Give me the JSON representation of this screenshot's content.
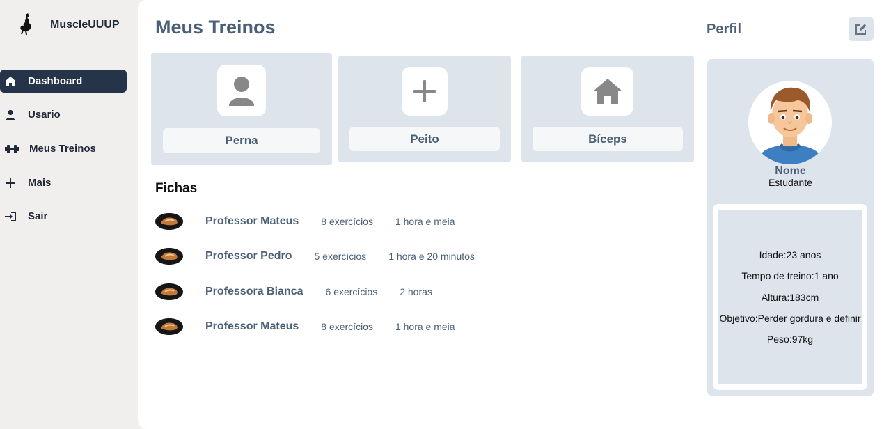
{
  "brand": {
    "name": "MuscleUUUP",
    "logo_icon": "muscle-logo-icon"
  },
  "sidebar": {
    "items": [
      {
        "label": "Dashboard",
        "icon": "home-icon",
        "active": true
      },
      {
        "label": "Usario",
        "icon": "user-icon",
        "active": false
      },
      {
        "label": "Meus Treinos",
        "icon": "dumbbell-icon",
        "active": false
      },
      {
        "label": "Mais",
        "icon": "plus-icon",
        "active": false
      },
      {
        "label": "Sair",
        "icon": "sign-out-icon",
        "active": false
      }
    ],
    "active_color": "#263449"
  },
  "main": {
    "title": "Meus Treinos",
    "cards": [
      {
        "label": "Perna",
        "icon": "user-icon"
      },
      {
        "label": "Peito",
        "icon": "plus-icon"
      },
      {
        "label": "Bíceps",
        "icon": "home-icon"
      }
    ],
    "fichas_title": "Fichas",
    "fichas": [
      {
        "name": "Professor Mateus",
        "exercises": "8 exercícios",
        "duration": "1 hora e meia"
      },
      {
        "name": "Professor Pedro",
        "exercises": "5 exercícios",
        "duration": "1 hora e 20 minutos"
      },
      {
        "name": "Professora Bianca",
        "exercises": "6 exercícios",
        "duration": "2 horas"
      },
      {
        "name": "Professor Mateus",
        "exercises": "8 exercícios",
        "duration": "1 hora e meia"
      }
    ]
  },
  "profile": {
    "title": "Perfil",
    "edit_icon": "edit-icon",
    "name": "Nome",
    "role": "Estudante",
    "info": [
      "Idade:23 anos",
      "Tempo de treino:1 ano",
      "Altura:183cm",
      "Objetivo:Perder gordura e definir",
      "Peso:97kg"
    ]
  },
  "colors": {
    "accent": "#4b6078",
    "card_bg": "#dde4ec",
    "sidebar_bg": "#f1eeee"
  }
}
